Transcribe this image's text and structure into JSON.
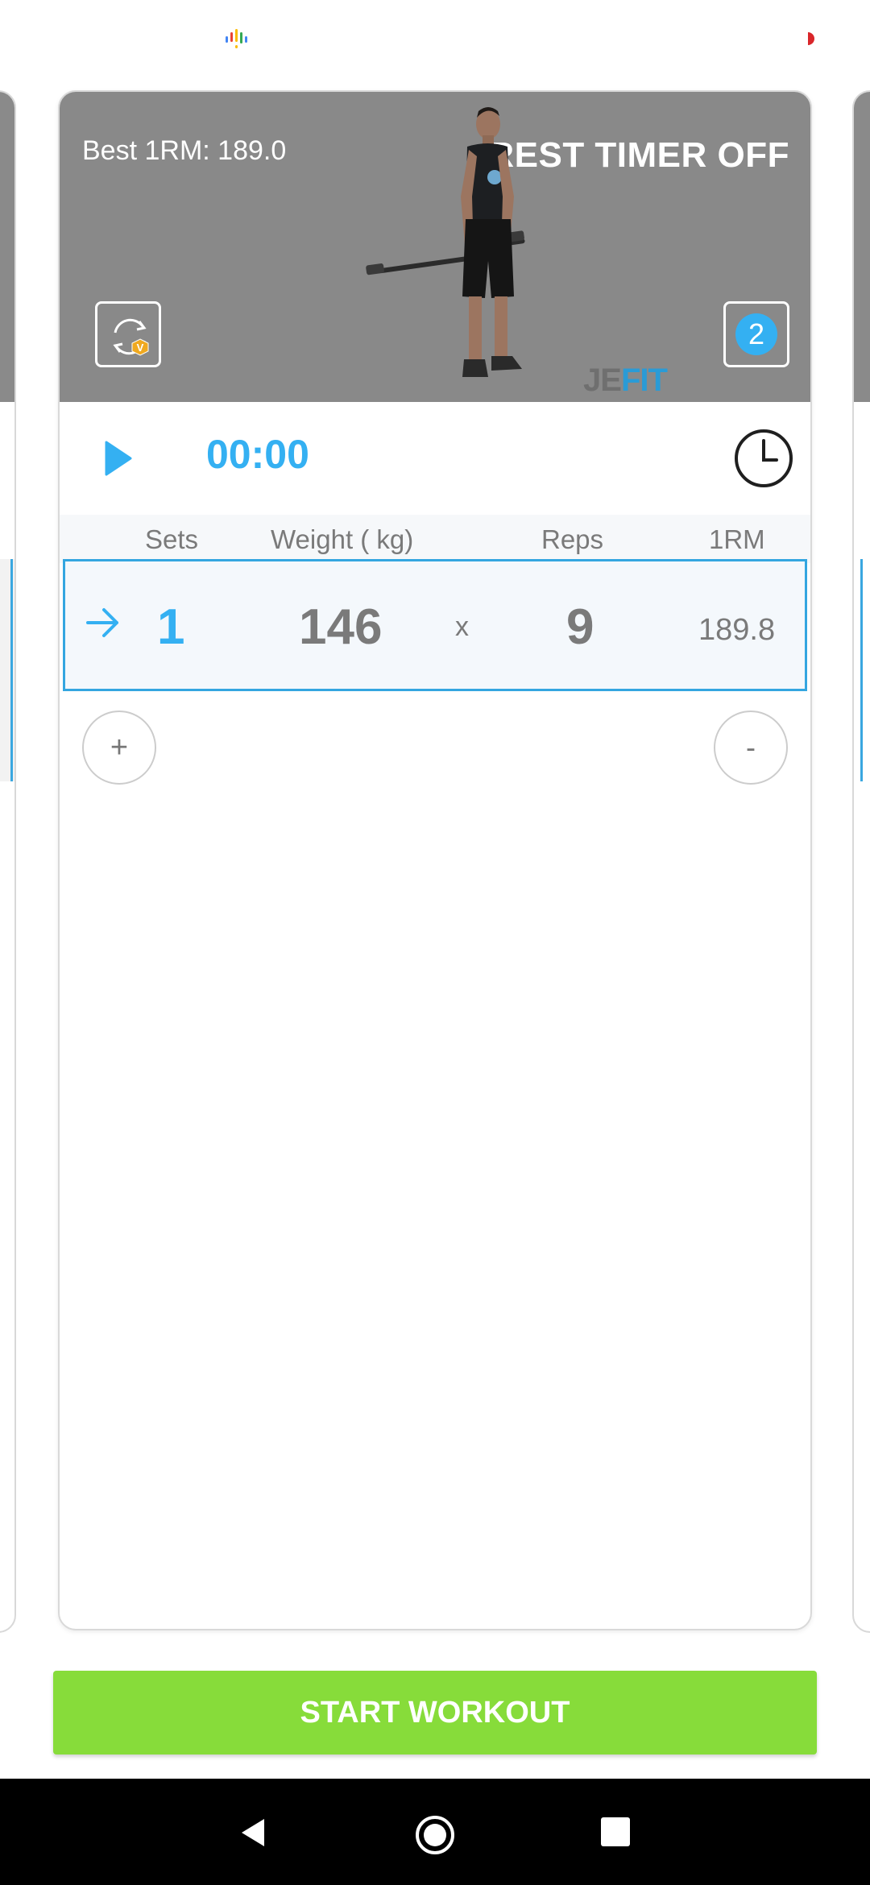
{
  "exercise": {
    "best_1rm": "Best 1RM: 189.0",
    "rest_timer": "REST TIMER OFF",
    "set_count_badge": "2",
    "logo_je": "JE",
    "logo_fit": "FIT"
  },
  "timer": {
    "elapsed": "00:00"
  },
  "table": {
    "headers": {
      "sets": "Sets",
      "weight": "Weight ( kg)",
      "reps": "Reps",
      "one_rm": "1RM"
    },
    "rows": [
      {
        "set": "1",
        "weight": "146",
        "separator": "x",
        "reps": "9",
        "one_rm": "189.8"
      }
    ]
  },
  "controls": {
    "add_set": "+",
    "remove_set": "-",
    "start_workout": "START WORKOUT"
  },
  "colors": {
    "accent_blue": "#34b0f2",
    "start_green": "#87dc3a",
    "hero_gray": "#898989"
  }
}
